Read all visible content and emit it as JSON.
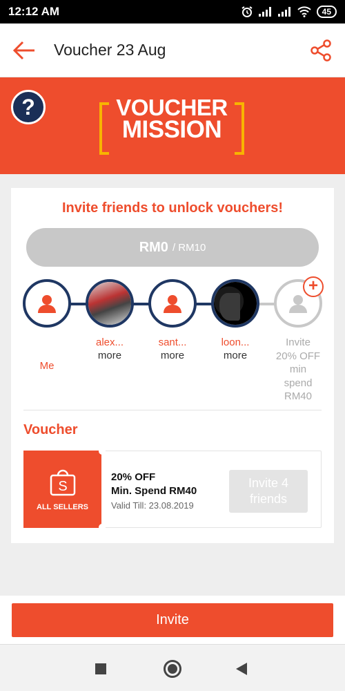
{
  "status_bar": {
    "time": "12:12 AM",
    "battery": "45"
  },
  "app_bar": {
    "title": "Voucher 23 Aug"
  },
  "banner": {
    "help": "?",
    "logo_line1": "VOUCHER",
    "logo_line2": "MISSION"
  },
  "mission": {
    "headline": "Invite friends to unlock vouchers!",
    "progress_current": "RM0",
    "progress_target": "/ RM10",
    "friends": [
      {
        "name": "Me",
        "more": ""
      },
      {
        "name": "alex...",
        "more": "more"
      },
      {
        "name": "sant...",
        "more": "more"
      },
      {
        "name": "loon...",
        "more": "more"
      }
    ],
    "invite_slot": {
      "line1": "Invite",
      "line2": "20% OFF",
      "line3": "min",
      "line4": "spend",
      "line5": "RM40"
    }
  },
  "voucher": {
    "section_title": "Voucher",
    "seller_label": "ALL SELLERS",
    "discount": "20% OFF",
    "min_spend": "Min. Spend RM40",
    "valid_till": "Valid Till: 23.08.2019",
    "button_line1": "Invite 4",
    "button_line2": "friends"
  },
  "footer": {
    "invite_button": "Invite"
  },
  "colors": {
    "brand": "#ee4d2d",
    "navy": "#1f3763",
    "gold": "#f8b400"
  }
}
